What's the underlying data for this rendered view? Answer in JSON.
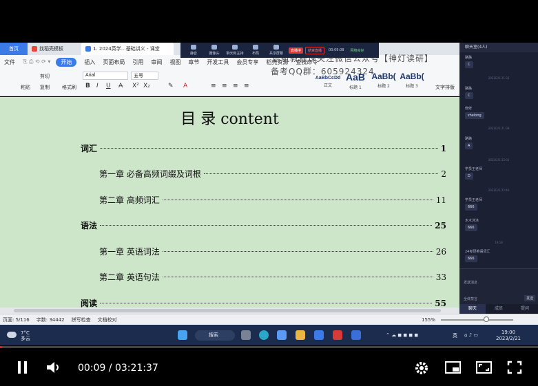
{
  "tabs": {
    "home": "首页",
    "t1": "找稻壳模板",
    "t2": "1. 2024英学…基础讲义 - 课堂"
  },
  "meeting": {
    "buttons": [
      "静音",
      "摄像头",
      "聊天和主持",
      "布局",
      "共享屏幕"
    ],
    "tag_live": "直播中",
    "tag_stop": "结束直播",
    "timer": "00:09:08",
    "tag_network": "网络良好"
  },
  "ribbon": {
    "menus": [
      "文件",
      "开始",
      "插入",
      "页面布局",
      "引用",
      "审阅",
      "视图",
      "章节",
      "开发工具",
      "会员专享",
      "稻壳资源",
      "查找命令"
    ],
    "font_name": "Arial",
    "font_size": "五号",
    "paste": "粘贴",
    "cut": "剪切",
    "copy": "复制",
    "format_painter": "格式刷",
    "styles": [
      {
        "preview": "AaBbCcDd",
        "label": "正文"
      },
      {
        "preview": "AaB",
        "label": "标题 1"
      },
      {
        "preview": "AaBb(",
        "label": "标题 2"
      },
      {
        "preview": "AaBb(",
        "label": "标题 3"
      }
    ],
    "text_layout": "文字排版",
    "watermark_line1": "启航教程课关注微信公众号【神灯读研】",
    "watermark_line2": "备考QQ群：605924324"
  },
  "document": {
    "title": "目  录 content",
    "toc": [
      {
        "level": 1,
        "text": "词汇",
        "page": "1"
      },
      {
        "level": 2,
        "text": "第一章   必备高频词缀及词根",
        "page": "2"
      },
      {
        "level": 2,
        "text": "第二章   高频词汇",
        "page": "11"
      },
      {
        "level": 1,
        "text": "语法",
        "page": "25"
      },
      {
        "level": 2,
        "text": "第一章   英语词法",
        "page": "26"
      },
      {
        "level": 2,
        "text": "第二章   英语句法",
        "page": "33"
      },
      {
        "level": 1,
        "text": "阅读",
        "page": "55"
      }
    ]
  },
  "status": {
    "page": "页面: 5/116",
    "words": "字数: 34442",
    "spell": "拼写检查",
    "proof": "文档校对",
    "zoom": "155%"
  },
  "chat": {
    "header": "聊天室(4人)",
    "messages": [
      {
        "name": "路路",
        "text": "C"
      },
      {
        "name": "路路",
        "text": "C"
      },
      {
        "name": "修修",
        "text": "zhelong"
      },
      {
        "name": "路路",
        "text": "A"
      },
      {
        "name": "学员王老师",
        "text": "D"
      },
      {
        "name": "学员王老师",
        "text": "666"
      },
      {
        "name": "木木沐沐",
        "text": "666"
      },
      {
        "name": "24考研英语词汇",
        "text": "666"
      }
    ],
    "timestamps": [
      "2023/2/1 21:33",
      "2023/2/1 21:38",
      "2023/2/1 22:01",
      "2023/2/1 22:40",
      "19:18"
    ],
    "input_hint": "发送消息",
    "all_members": "全体禁言",
    "send": "发送",
    "tabs": [
      "聊天",
      "成员",
      "提问"
    ]
  },
  "taskbar": {
    "temp": "7°C",
    "weather": "多云",
    "search": "搜索",
    "ime": "英",
    "time": "19:00",
    "date": "2023/2/21"
  },
  "player": {
    "time": "00:09 / 03:21:37",
    "progress": 0.0005
  }
}
